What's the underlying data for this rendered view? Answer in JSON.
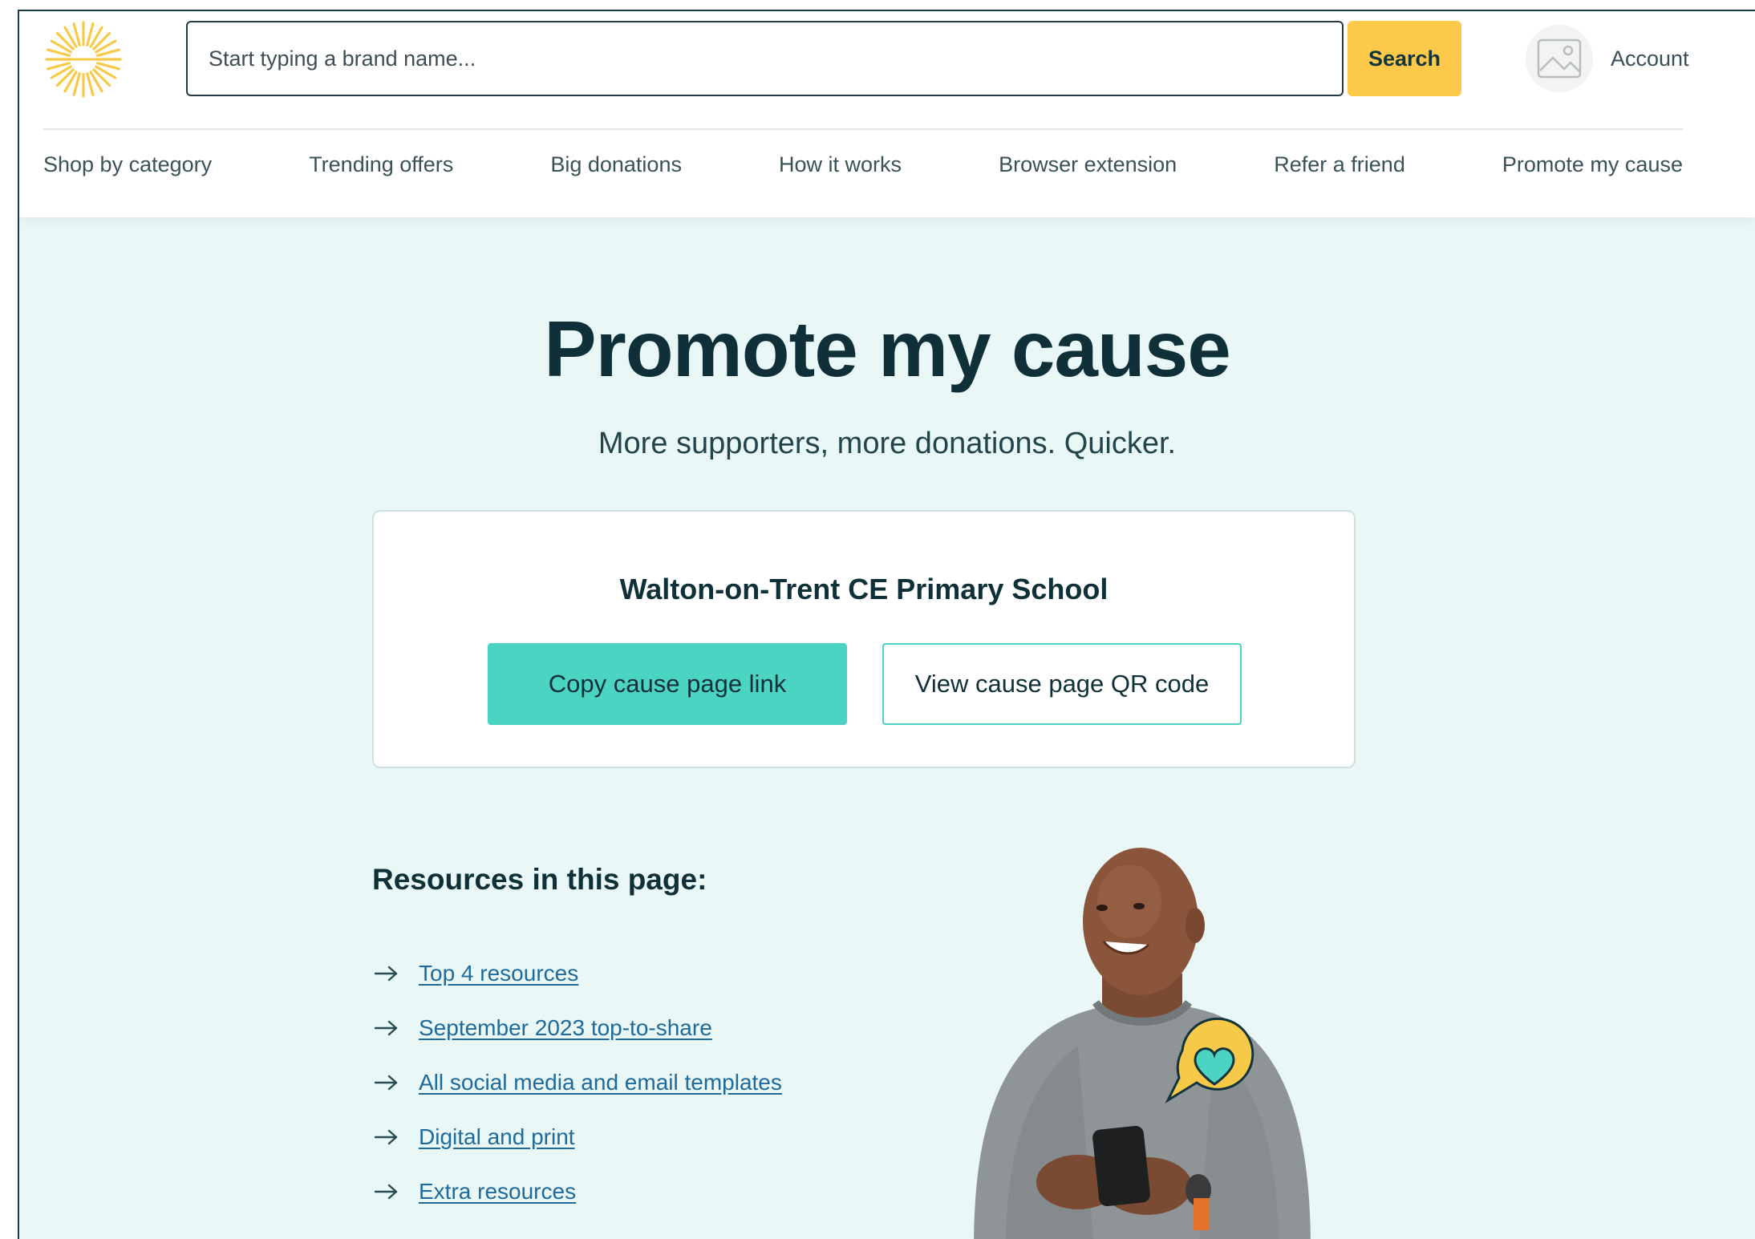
{
  "header": {
    "search": {
      "placeholder": "Start typing a brand name...",
      "button_label": "Search"
    },
    "account_label": "Account"
  },
  "nav": {
    "items": [
      "Shop by category",
      "Trending offers",
      "Big donations",
      "How it works",
      "Browser extension",
      "Refer a friend",
      "Promote my cause"
    ]
  },
  "hero": {
    "title": "Promote my cause",
    "subtitle": "More supporters, more donations. Quicker."
  },
  "cause_card": {
    "cause_name": "Walton-on-Trent CE Primary School",
    "copy_button_label": "Copy cause page link",
    "qr_button_label": "View cause page QR code"
  },
  "resources": {
    "heading": "Resources in this page:",
    "links": [
      "Top 4 resources",
      "September 2023 top-to-share",
      "All social media and email templates",
      "Digital and print",
      "Extra resources"
    ]
  },
  "colors": {
    "page_background": "#e9f8f6",
    "accent_teal": "#4bd4c1",
    "search_yellow": "#fdc94a",
    "logo_yellow": "#f7c948",
    "heading_dark": "#0f3038",
    "link_blue": "#1f6a9b"
  },
  "icons": {
    "logo": "sun-rays-logo",
    "avatar": "image-placeholder-icon",
    "resource_arrow": "arrow-right-icon",
    "heart_badge": "heart-speech-bubble-icon"
  }
}
